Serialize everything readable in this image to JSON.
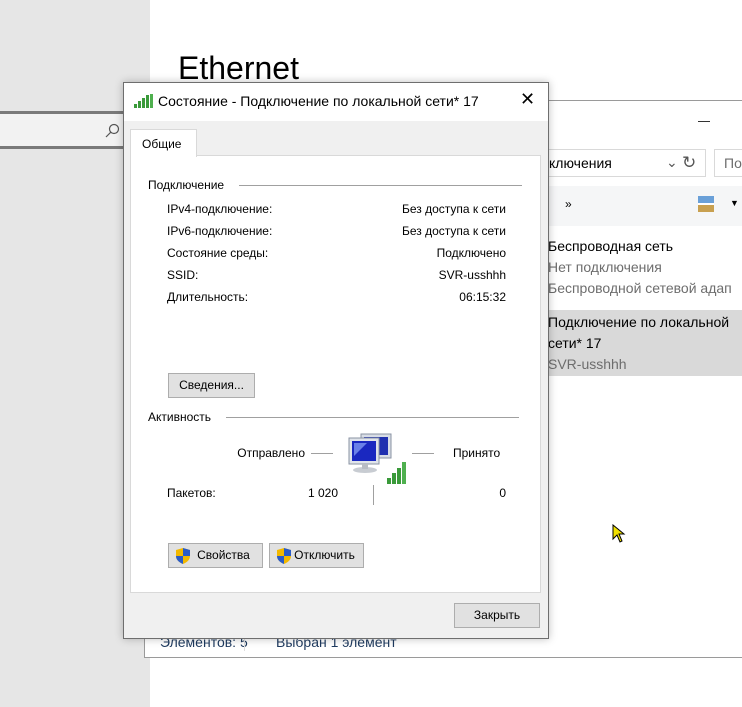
{
  "background": {
    "page_title": "Ethernet",
    "explorer": {
      "address_text": "ключения",
      "search_placeholder": "По",
      "more_label": "»",
      "items": [
        {
          "name": "Беспроводная сеть",
          "status": "Нет подключения",
          "device": "Беспроводной сетевой адап"
        },
        {
          "name_line1": "Подключение по локальной",
          "name_line2": "сети* 17",
          "status": "SVR-usshhh"
        }
      ],
      "statusbar": {
        "count": "Элементов: 5",
        "selected": "Выбран 1 элемент"
      }
    }
  },
  "dialog": {
    "title": "Состояние - Подключение по локальной сети* 17",
    "tab": "Общие",
    "connection": {
      "heading": "Подключение",
      "rows": [
        {
          "label": "IPv4-подключение:",
          "value": "Без доступа к сети"
        },
        {
          "label": "IPv6-подключение:",
          "value": "Без доступа к сети"
        },
        {
          "label": "Состояние среды:",
          "value": "Подключено"
        },
        {
          "label": "SSID:",
          "value": "SVR-usshhh"
        },
        {
          "label": "Длительность:",
          "value": "06:15:32"
        }
      ],
      "details_button": "Сведения..."
    },
    "activity": {
      "heading": "Активность",
      "sent_label": "Отправлено",
      "received_label": "Принято",
      "packets_label": "Пакетов:",
      "packets_sent": "1 020",
      "packets_received": "0"
    },
    "properties_button": "Свойства",
    "disable_button": "Отключить",
    "close_button": "Закрыть"
  }
}
